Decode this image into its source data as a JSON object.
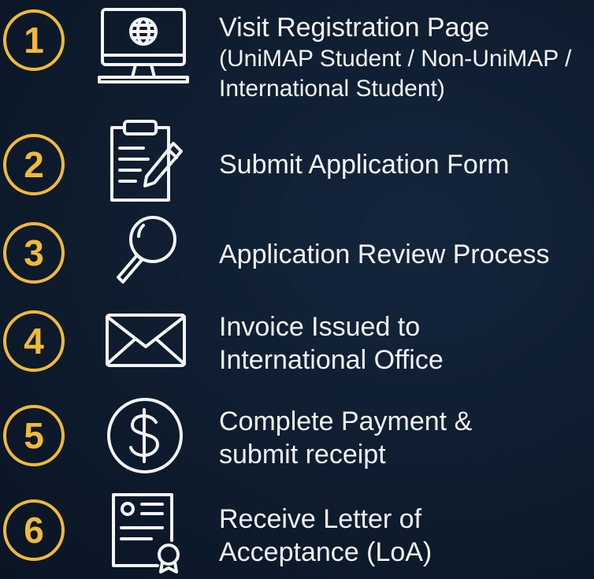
{
  "colors": {
    "background": "#0e1c2e",
    "accent": "#f0b93a",
    "text": "#f2f4f6",
    "icon_stroke": "#f2f4f6"
  },
  "steps": [
    {
      "number": "1",
      "icon": "computer-globe-icon",
      "title": "Visit Registration Page",
      "subtitle_1": "(UniMAP Student / Non-UniMAP /",
      "subtitle_2": "International Student)"
    },
    {
      "number": "2",
      "icon": "clipboard-pencil-icon",
      "title": "Submit Application Form"
    },
    {
      "number": "3",
      "icon": "magnifying-glass-icon",
      "title": "Application Review Process"
    },
    {
      "number": "4",
      "icon": "envelope-icon",
      "title_1": "Invoice Issued to",
      "title_2": "International Office"
    },
    {
      "number": "5",
      "icon": "dollar-coin-icon",
      "title_1": "Complete Payment &",
      "title_2": "submit receipt"
    },
    {
      "number": "6",
      "icon": "certificate-icon",
      "title_1": "Receive Letter of",
      "title_2": "Acceptance (LoA)"
    }
  ]
}
